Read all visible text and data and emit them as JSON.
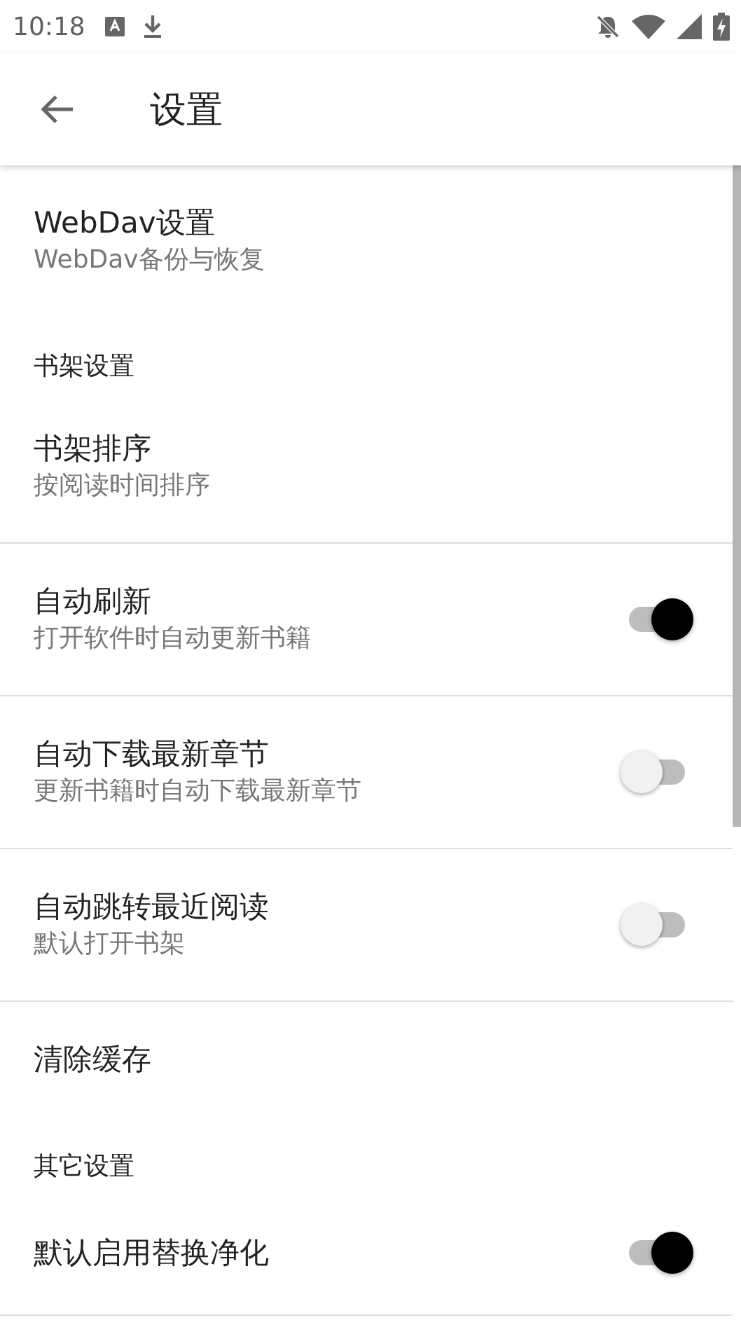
{
  "status_bar": {
    "time": "10:18"
  },
  "app_bar": {
    "title": "设置"
  },
  "settings": [
    {
      "kind": "item",
      "title": "WebDav设置",
      "summary": "WebDav备份与恢复",
      "divider": false
    },
    {
      "kind": "category",
      "title": "书架设置"
    },
    {
      "kind": "item",
      "title": "书架排序",
      "summary": "按阅读时间排序",
      "divider": true
    },
    {
      "kind": "switch",
      "title": "自动刷新",
      "summary": "打开软件时自动更新书籍",
      "on": true,
      "divider": true
    },
    {
      "kind": "switch",
      "title": "自动下载最新章节",
      "summary": "更新书籍时自动下载最新章节",
      "on": false,
      "divider": true
    },
    {
      "kind": "switch",
      "title": "自动跳转最近阅读",
      "summary": "默认打开书架",
      "on": false,
      "divider": true
    },
    {
      "kind": "item",
      "title": "清除缓存",
      "divider": false
    },
    {
      "kind": "category",
      "title": "其它设置"
    },
    {
      "kind": "switch",
      "title": "默认启用替换净化",
      "on": true,
      "divider": true
    }
  ]
}
